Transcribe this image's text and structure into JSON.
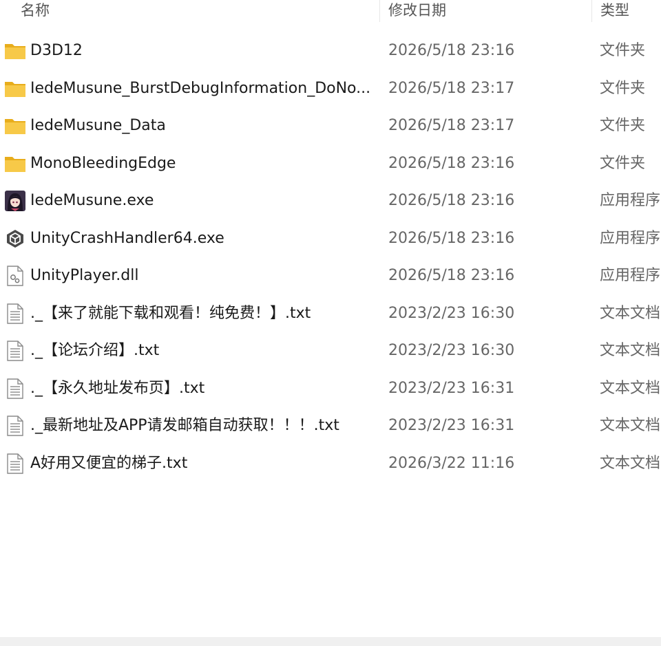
{
  "columns": {
    "name": "名称",
    "date": "修改日期",
    "type": "类型"
  },
  "files": [
    {
      "name": "D3D12",
      "date": "2026/5/18 23:16",
      "type": "文件夹",
      "icon": "folder-icon"
    },
    {
      "name": "IedeMusune_BurstDebugInformation_DoNo...",
      "date": "2026/5/18 23:17",
      "type": "文件夹",
      "icon": "folder-icon"
    },
    {
      "name": "IedeMusune_Data",
      "date": "2026/5/18 23:17",
      "type": "文件夹",
      "icon": "folder-icon"
    },
    {
      "name": "MonoBleedingEdge",
      "date": "2026/5/18 23:16",
      "type": "文件夹",
      "icon": "folder-icon"
    },
    {
      "name": "IedeMusune.exe",
      "date": "2026/5/18 23:16",
      "type": "应用程序",
      "icon": "app-character-icon"
    },
    {
      "name": "UnityCrashHandler64.exe",
      "date": "2026/5/18 23:16",
      "type": "应用程序",
      "icon": "unity-icon"
    },
    {
      "name": "UnityPlayer.dll",
      "date": "2026/5/18 23:16",
      "type": "应用程序",
      "icon": "dll-file-icon"
    },
    {
      "name": "._【来了就能下载和观看！纯免费！】.txt",
      "date": "2023/2/23 16:30",
      "type": "文本文档",
      "icon": "text-file-icon"
    },
    {
      "name": "._【论坛介绍】.txt",
      "date": "2023/2/23 16:30",
      "type": "文本文档",
      "icon": "text-file-icon"
    },
    {
      "name": "._【永久地址发布页】.txt",
      "date": "2023/2/23 16:31",
      "type": "文本文档",
      "icon": "text-file-icon"
    },
    {
      "name": "._最新地址及APP请发邮箱自动获取！！！.txt",
      "date": "2023/2/23 16:31",
      "type": "文本文档",
      "icon": "text-file-icon"
    },
    {
      "name": "A好用又便宜的梯子.txt",
      "date": "2026/3/22 11:16",
      "type": "文本文档",
      "icon": "text-file-icon"
    }
  ],
  "colors": {
    "folder": "#f7c948",
    "folder_dark": "#e8ad1c",
    "text_primary": "#1a1a1a",
    "text_secondary": "#666666"
  }
}
